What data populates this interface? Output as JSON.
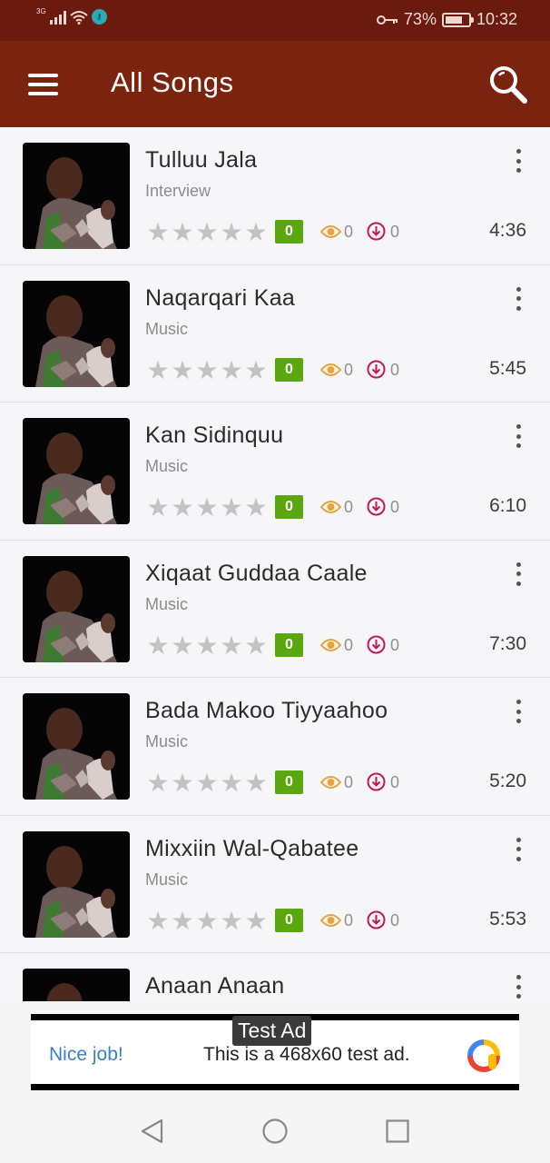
{
  "status_bar": {
    "network": "3G",
    "app_icon": "key-app-icon",
    "battery": "73%",
    "battery_level": 0.73,
    "time": "10:32"
  },
  "toolbar": {
    "title": "All Songs",
    "menu_icon": "hamburger-menu-icon",
    "search_icon": "search-icon"
  },
  "colors": {
    "status_bar": "#6a1b0e",
    "toolbar": "#7a230f",
    "badge": "#5aa80d",
    "eye": "#e8a33a",
    "download": "#c2185b",
    "star": "#c2c2c2"
  },
  "songs": [
    {
      "title": "Tulluu Jala",
      "category": "Interview",
      "rating": "0",
      "views": "0",
      "downloads": "0",
      "duration": "4:36"
    },
    {
      "title": "Naqarqari Kaa",
      "category": "Music",
      "rating": "0",
      "views": "0",
      "downloads": "0",
      "duration": "5:45"
    },
    {
      "title": "Kan Sidinquu",
      "category": "Music",
      "rating": "0",
      "views": "0",
      "downloads": "0",
      "duration": "6:10"
    },
    {
      "title": "Xiqaat Guddaa Caale",
      "category": "Music",
      "rating": "0",
      "views": "0",
      "downloads": "0",
      "duration": "7:30"
    },
    {
      "title": "Bada Makoo Tiyyaahoo",
      "category": "Music",
      "rating": "0",
      "views": "0",
      "downloads": "0",
      "duration": "5:20"
    },
    {
      "title": "Mixxiin Wal-Qabatee",
      "category": "Music",
      "rating": "0",
      "views": "0",
      "downloads": "0",
      "duration": "5:53"
    },
    {
      "title": "Anaan Anaan",
      "category": "",
      "rating": "",
      "views": "",
      "downloads": "",
      "duration": ""
    }
  ],
  "ad": {
    "label": "Test Ad",
    "nice": "Nice job!",
    "text": "This is a 468x60 test ad."
  },
  "nav": {
    "back_icon": "back-triangle-icon",
    "home_icon": "home-circle-icon",
    "recents_icon": "recents-square-icon"
  }
}
